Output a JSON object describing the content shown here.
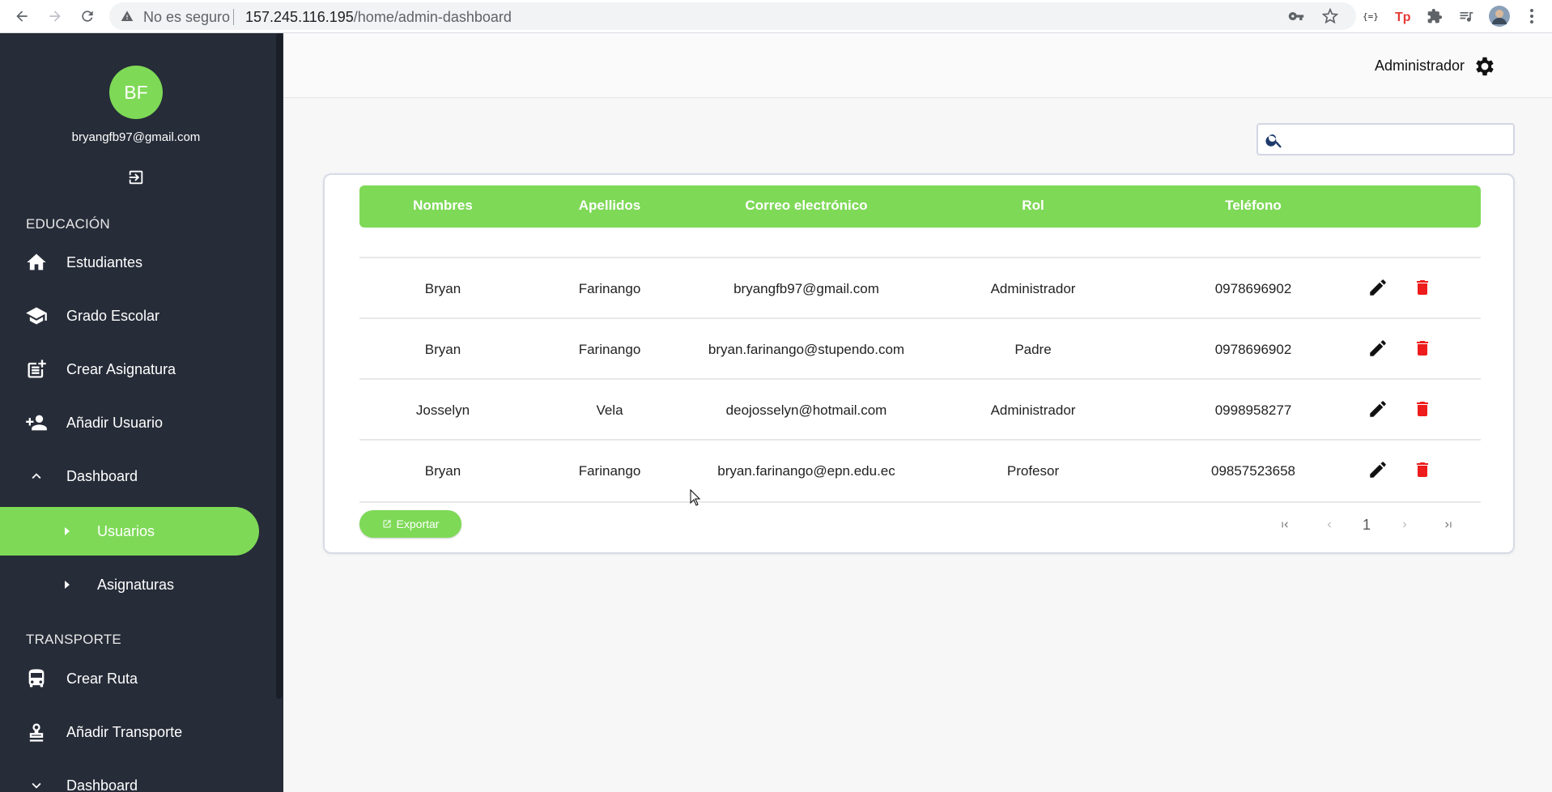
{
  "browser": {
    "security_text": "No es seguro",
    "url_host": "157.245.116.195",
    "url_path": "/home/admin-dashboard"
  },
  "sidebar": {
    "avatar_initials": "BF",
    "user_email": "bryangfb97@gmail.com",
    "sections": [
      {
        "title": "EDUCACIÓN",
        "items": [
          {
            "label": "Estudiantes",
            "icon": "home-icon"
          },
          {
            "label": "Grado Escolar",
            "icon": "school-icon"
          },
          {
            "label": "Crear Asignatura",
            "icon": "post-add-icon"
          },
          {
            "label": "Añadir Usuario",
            "icon": "person-add-icon"
          },
          {
            "label": "Dashboard",
            "icon": "chevron-up-icon"
          }
        ],
        "subitems": [
          {
            "label": "Usuarios",
            "active": true
          },
          {
            "label": "Asignaturas",
            "active": false
          }
        ]
      },
      {
        "title": "TRANSPORTE",
        "items": [
          {
            "label": "Crear Ruta",
            "icon": "bus-icon"
          },
          {
            "label": "Añadir Transporte",
            "icon": "stamp-icon"
          },
          {
            "label": "Dashboard",
            "icon": "chevron-down-icon"
          }
        ]
      }
    ]
  },
  "header": {
    "role_label": "Administrador"
  },
  "search": {
    "placeholder": ""
  },
  "table": {
    "columns": [
      "Nombres",
      "Apellidos",
      "Correo electrónico",
      "Rol",
      "Teléfono"
    ],
    "rows": [
      [
        "Bryan",
        "Farinango",
        "bryangfb97@gmail.com",
        "Administrador",
        "0978696902"
      ],
      [
        "Bryan",
        "Farinango",
        "bryan.farinango@stupendo.com",
        "Padre",
        "0978696902"
      ],
      [
        "Josselyn",
        "Vela",
        "deojosselyn@hotmail.com",
        "Administrador",
        "0998958277"
      ],
      [
        "Bryan",
        "Farinango",
        "bryan.farinango@epn.edu.ec",
        "Profesor",
        "09857523658"
      ]
    ]
  },
  "footer": {
    "export_label": "Exportar",
    "current_page": "1"
  },
  "colors": {
    "accent": "#7ed957",
    "sidebar_bg": "#262c38",
    "delete": "#ee1c1c"
  }
}
